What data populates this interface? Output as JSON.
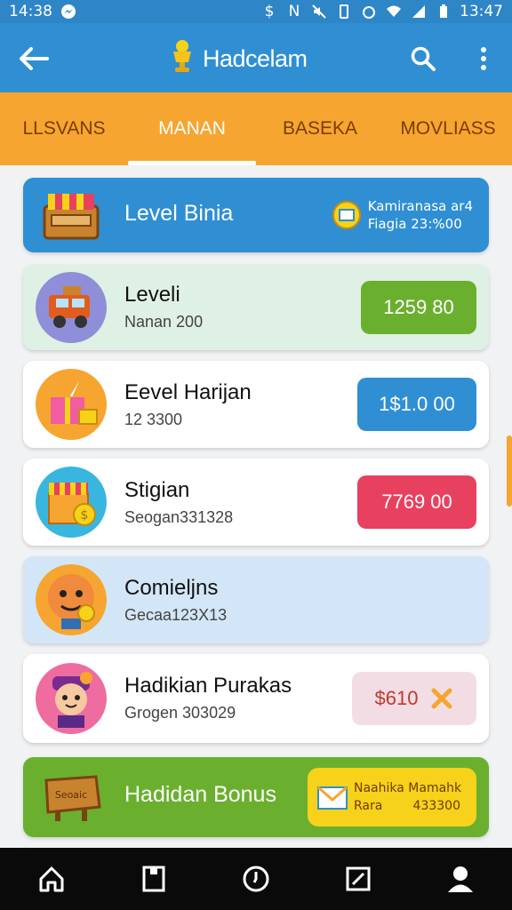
{
  "status_bar": {
    "time_left": "14:38",
    "time_right": "13:47"
  },
  "app_bar": {
    "title": "Hadcelam"
  },
  "tabs": [
    {
      "label": "LLSVANS",
      "active": false
    },
    {
      "label": "MANAN",
      "active": true
    },
    {
      "label": "BASEKA",
      "active": false
    },
    {
      "label": "MOVLIASS",
      "active": false
    }
  ],
  "top_banner": {
    "title": "Level Binia",
    "info_line1": "Kamiranasa ar4",
    "info_line2": "Fiagia 23:%00"
  },
  "items": [
    {
      "name": "Leveli",
      "sub": "Nanan 200",
      "amount": "1259 80",
      "color": "#6ab02e",
      "bg": "#dff0e4",
      "avatar": "truck-icon"
    },
    {
      "name": "Eevel Harijan",
      "sub": "12 3300",
      "amount": "1$1.0 00",
      "color": "#2f8fd2",
      "bg": "#ffffff",
      "avatar": "gift-icon"
    },
    {
      "name": "Stigian",
      "sub": "Seogan331328",
      "amount": "7769 00",
      "color": "#e8405f",
      "bg": "#ffffff",
      "avatar": "treasure-chest-icon"
    },
    {
      "name": "Comieljns",
      "sub": "Gecaa123X13",
      "amount": "",
      "color": "",
      "bg": "#d3e6f7",
      "avatar": "character-icon"
    },
    {
      "name": "Hadikian Purakas",
      "sub": "Grogen 303029",
      "amount": "$610",
      "color": "#f3dde4",
      "bg": "#ffffff",
      "avatar": "kid-character-icon"
    }
  ],
  "bonus_banner": {
    "title": "Hadidan Bonus",
    "sign_text": "Seoaic",
    "info_line1": "Naahika Mamahk",
    "info_label": "Rara",
    "info_value": "433300"
  },
  "colors": {
    "primary": "#2f8fd2",
    "accent": "#f6a530",
    "green": "#6ab02e",
    "red": "#e8405f"
  }
}
